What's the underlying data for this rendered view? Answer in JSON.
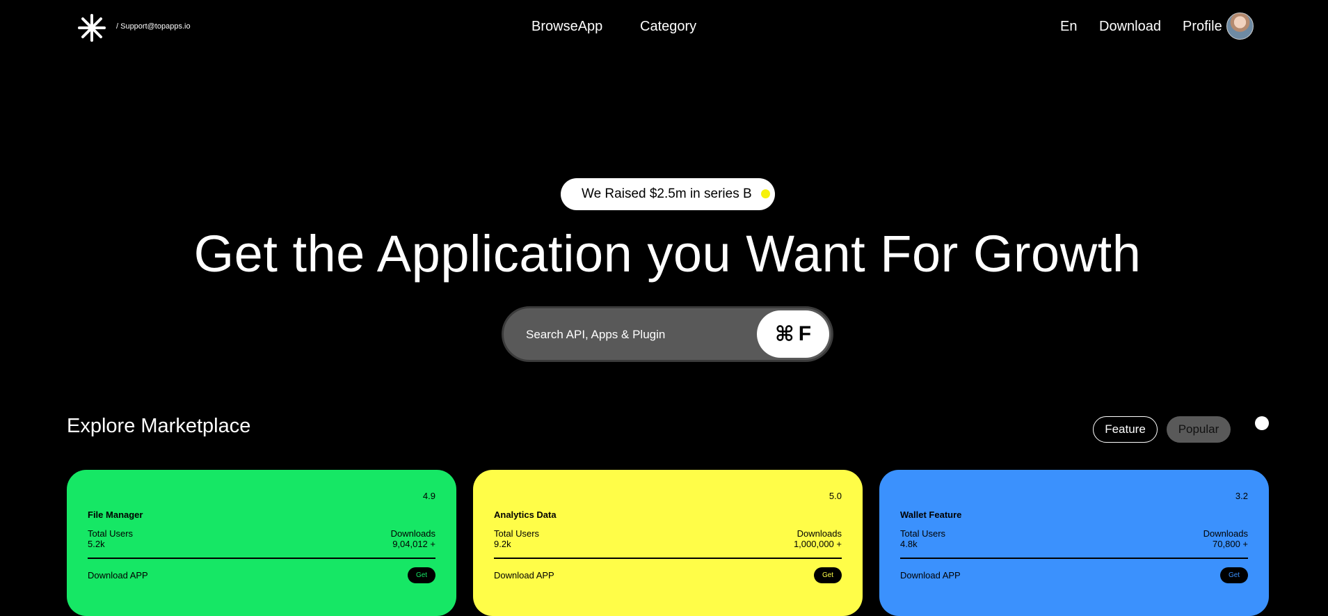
{
  "header": {
    "support": "/ Support@topapps.io",
    "nav": [
      "BrowseApp",
      "Category"
    ],
    "right": {
      "lang": "En",
      "download": "Download",
      "profile": "Profile"
    }
  },
  "hero": {
    "badge": "We Raised $2.5m in series B",
    "title": "Get the Application you Want For Growth"
  },
  "search": {
    "placeholder": "Search API, Apps & Plugin",
    "shortcut_symbol": "⌘",
    "shortcut_key": "F"
  },
  "marketplace": {
    "title": "Explore Marketplace",
    "filters": [
      "Feature",
      "Popular"
    ],
    "cards": [
      {
        "name": "File Manager",
        "rating": "4.9",
        "users_label": "Total Users",
        "users": "5.2k",
        "downloads_label": "Downloads",
        "downloads": "9,04,012 +",
        "cta": "Download APP",
        "get": "Get",
        "color": "#16e765",
        "get_text_color": "#16e765"
      },
      {
        "name": "Analytics Data",
        "rating": "5.0",
        "users_label": "Total Users",
        "users": "9.2k",
        "downloads_label": "Downloads",
        "downloads": "1,000,000 +",
        "cta": "Download APP",
        "get": "Get",
        "color": "#fffd48",
        "get_text_color": "#fffd48"
      },
      {
        "name": "Wallet Feature",
        "rating": "3.2",
        "users_label": "Total Users",
        "users": "4.8k",
        "downloads_label": "Downloads",
        "downloads": "70,800 +",
        "cta": "Download APP",
        "get": "Get",
        "color": "#3b91fd",
        "get_text_color": "#3b91fd"
      }
    ]
  }
}
